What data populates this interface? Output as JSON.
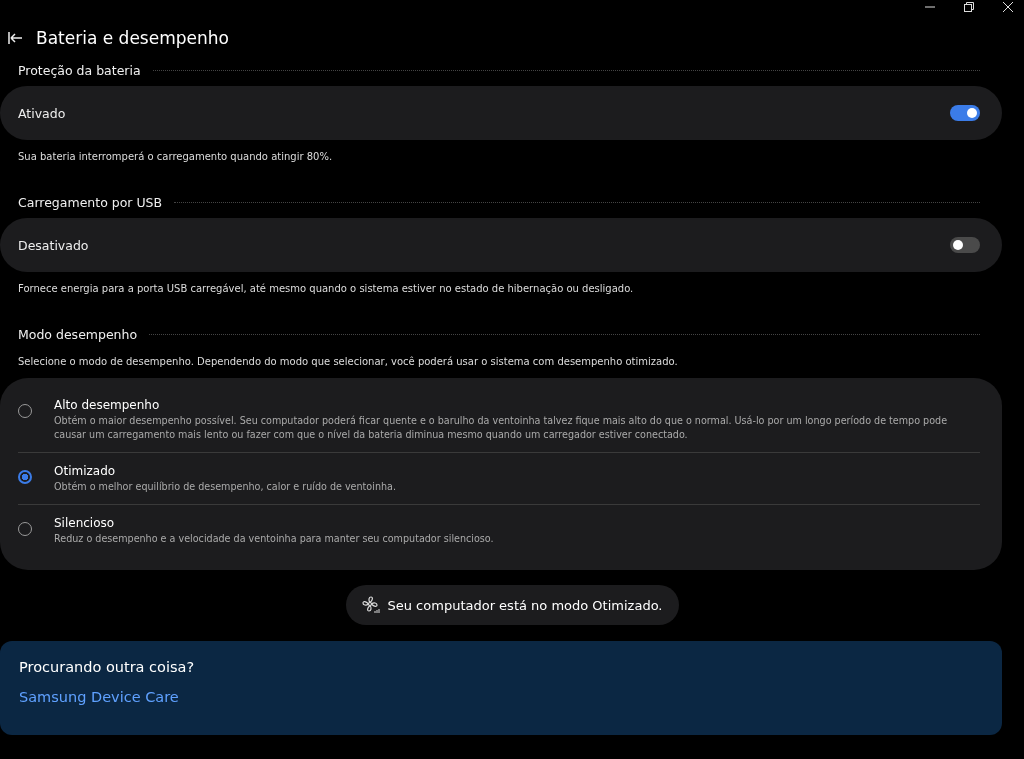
{
  "window": {
    "title": "Bateria e desempenho"
  },
  "sections": [
    {
      "kind": "toggle",
      "heading": "Proteção da bateria",
      "label": "Ativado",
      "on": true,
      "description": "Sua bateria interromperá o carregamento quando atingir 80%."
    },
    {
      "kind": "toggle",
      "heading": "Carregamento por USB",
      "label": "Desativado",
      "on": false,
      "description": "Fornece energia para a porta USB carregável, até mesmo quando o sistema estiver no estado de hibernação ou desligado."
    },
    {
      "kind": "radio",
      "heading": "Modo desempenho",
      "description": "Selecione o modo de desempenho. Dependendo do modo que selecionar, você poderá usar o sistema com desempenho otimizado.",
      "options": [
        {
          "label": "Alto desempenho",
          "description": "Obtém o maior desempenho possível. Seu computador poderá ficar quente e o barulho da ventoinha talvez fique mais alto do que o normal. Usá-lo por um longo período de tempo pode causar um carregamento mais lento ou fazer com que o nível da bateria diminua mesmo quando um carregador estiver conectado.",
          "selected": false
        },
        {
          "label": "Otimizado",
          "description": "Obtém o melhor equilíbrio de desempenho, calor e ruído de ventoinha.",
          "selected": true
        },
        {
          "label": "Silencioso",
          "description": "Reduz o desempenho e a velocidade da ventoinha para manter seu computador silencioso.",
          "selected": false
        }
      ]
    }
  ],
  "status": {
    "text": "Seu computador está no modo Otimizado."
  },
  "footer": {
    "heading": "Procurando outra coisa?",
    "link": "Samsung Device Care"
  }
}
